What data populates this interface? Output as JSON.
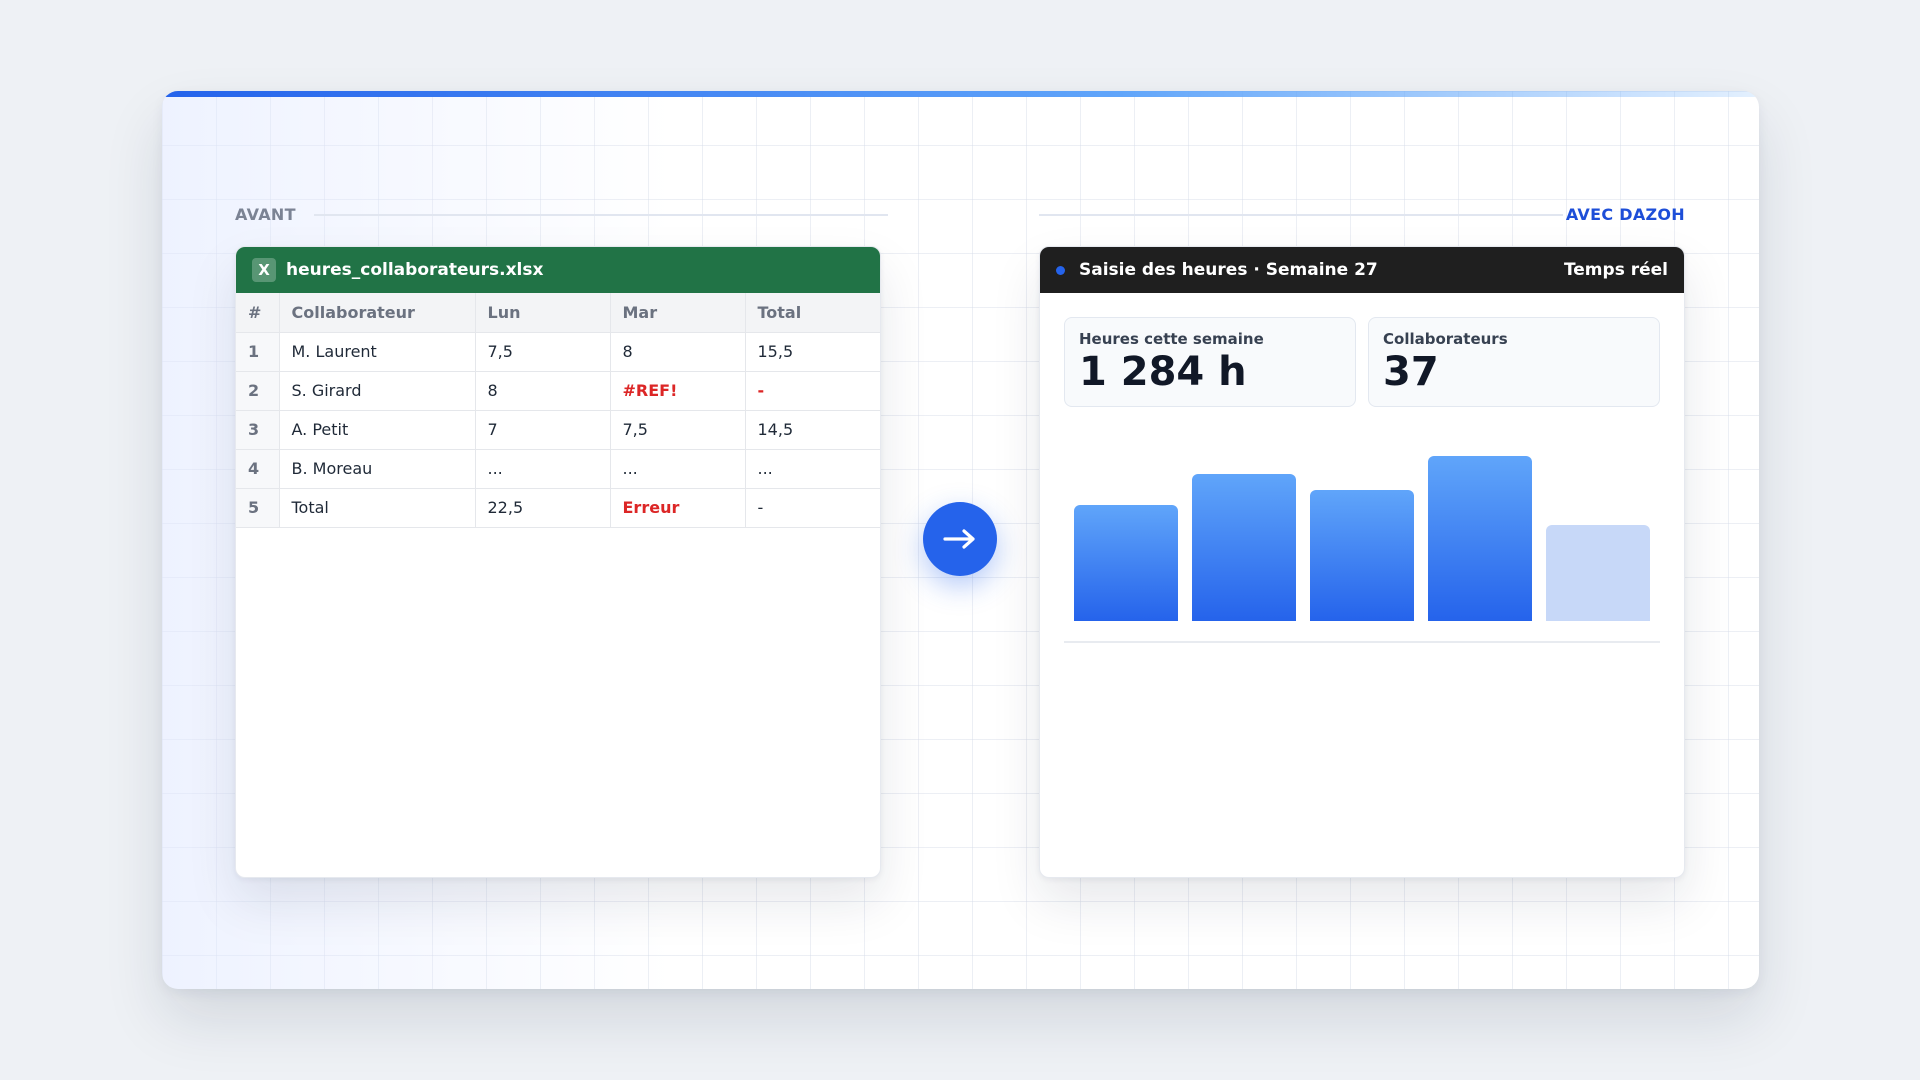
{
  "labels": {
    "before": "AVANT",
    "after": "AVEC DAZOH"
  },
  "spreadsheet": {
    "filename": "heures_collaborateurs.xlsx",
    "icon_letter": "X",
    "columns": [
      "#",
      "Collaborateur",
      "Lun",
      "Mar",
      "Total"
    ],
    "rows": [
      [
        "1",
        "M. Laurent",
        "7,5",
        "8",
        "15,5"
      ],
      [
        "2",
        "S. Girard",
        "8",
        "#REF!",
        "-"
      ],
      [
        "3",
        "A. Petit",
        "7",
        "7,5",
        "14,5"
      ],
      [
        "4",
        "B. Moreau",
        "...",
        "...",
        "..."
      ],
      [
        "5",
        "Total",
        "22,5",
        "Erreur",
        "-"
      ]
    ]
  },
  "dashboard": {
    "title": "Saisie des heures · Semaine 27",
    "status": "Temps réel",
    "stats": [
      {
        "label": "Heures cette semaine",
        "value": "1 284 h"
      },
      {
        "label": "Collaborateurs",
        "value": "37"
      }
    ]
  },
  "chart_data": {
    "type": "bar",
    "categories": [
      "",
      "",
      "",
      "",
      ""
    ],
    "values": [
      59,
      75,
      67,
      84,
      49
    ],
    "ylim": [
      0,
      100
    ],
    "styles": [
      "active",
      "active",
      "active",
      "active",
      "pending"
    ]
  },
  "colors": {
    "accent": "#2563eb",
    "excel_green": "#217346",
    "error": "#dc2626",
    "dark_header": "#1f1f1f",
    "pending_bar": "#c7d8f8"
  },
  "icons": {
    "arrow": "arrow-right-icon",
    "file": "excel-icon",
    "live": "live-dot-icon"
  }
}
